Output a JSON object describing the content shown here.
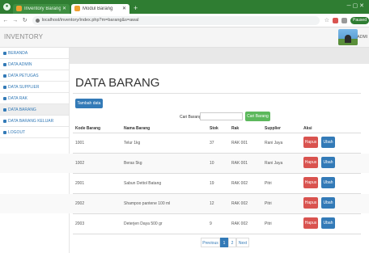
{
  "browser": {
    "tabs": [
      {
        "title": "Inventory Barang",
        "active": false
      },
      {
        "title": "Modul Barang",
        "active": true
      }
    ],
    "url": "localhost/inventory/index.php?m=barang&s=awal",
    "profile_label": "Paused"
  },
  "app": {
    "brand": "INVENTORY",
    "user_label": "ADMI"
  },
  "sidebar": {
    "items": [
      {
        "label": "BERANDA"
      },
      {
        "label": "DATA ADMIN"
      },
      {
        "label": "DATA PETUGAS"
      },
      {
        "label": "DATA SUPPLIER"
      },
      {
        "label": "DATA RAK"
      },
      {
        "label": "DATA BARANG"
      },
      {
        "label": "DATA BARANG KELUAR"
      },
      {
        "label": "LOGOUT"
      }
    ]
  },
  "main": {
    "title": "DATA BARANG",
    "add_button": "Tambah data",
    "search_label": "Cari Barang",
    "search_value": "",
    "search_button": "Cari Barang",
    "columns": [
      "Kode Barang",
      "Nama Barang",
      "Stok",
      "Rak",
      "Supplier",
      "Aksi"
    ],
    "rows": [
      {
        "kode": "1001",
        "nama": "Telur 1kg",
        "stok": "37",
        "rak": "RAK 001",
        "supplier": "Rani Jaya",
        "hapus": "Hapus",
        "ubah": "Ubah"
      },
      {
        "kode": "1002",
        "nama": "Beras 5kg",
        "stok": "10",
        "rak": "RAK 001",
        "supplier": "Rani Jaya",
        "hapus": "Hapus",
        "ubah": "Ubah"
      },
      {
        "kode": "2001",
        "nama": "Sabun Dettol Batang",
        "stok": "19",
        "rak": "RAK 002",
        "supplier": "Pitri",
        "hapus": "Hapus",
        "ubah": "Ubah"
      },
      {
        "kode": "2002",
        "nama": "Shampoo pantene 100 ml",
        "stok": "12",
        "rak": "RAK 002",
        "supplier": "Pitri",
        "hapus": "Hapus",
        "ubah": "Ubah"
      },
      {
        "kode": "2003",
        "nama": "Deterjen Daya 500 gr",
        "stok": "9",
        "rak": "RAK 002",
        "supplier": "Pitri",
        "hapus": "Hapus",
        "ubah": "Ubah"
      }
    ],
    "pagination": {
      "previous": "Previous",
      "pages": [
        "1",
        "2"
      ],
      "next": "Next"
    }
  }
}
